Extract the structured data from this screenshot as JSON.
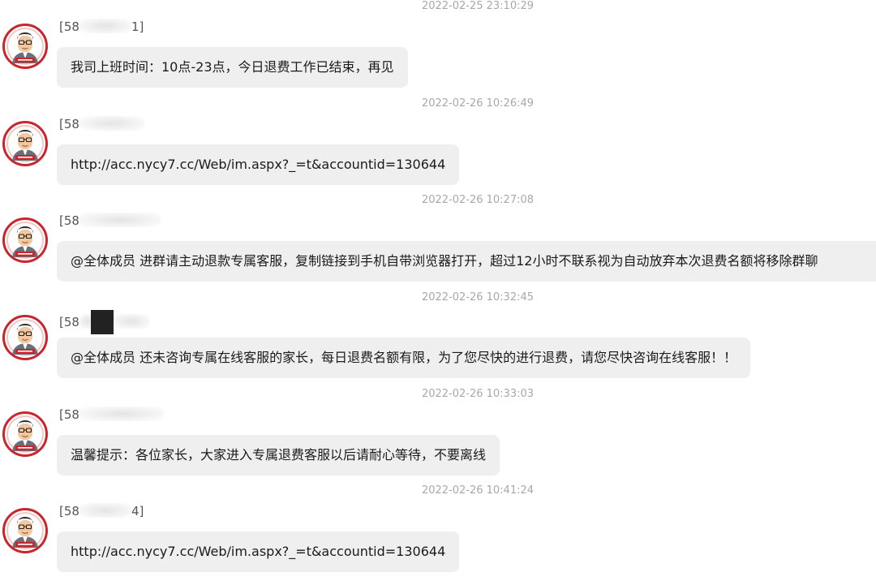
{
  "messages": [
    {
      "timestamp": "2022-02-25 23:10:29",
      "sender_prefix": "[58",
      "sender_suffix": "1]",
      "text": "我司上班时间：10点-23点，今日退费工作已结束，再见"
    },
    {
      "timestamp": "2022-02-26 10:26:49",
      "sender_prefix": "[58",
      "sender_suffix": "",
      "text": "http://acc.nycy7.cc/Web/im.aspx?_=t&accountid=130644"
    },
    {
      "timestamp": "2022-02-26 10:27:08",
      "sender_prefix": "[58",
      "sender_suffix": "",
      "text": "@全体成员 进群请主动退款专属客服，复制链接到手机自带浏览器打开，超过12小时不联系视为自动放弃本次退费名额将移除群聊"
    },
    {
      "timestamp": "2022-02-26 10:32:45",
      "sender_prefix": "[58",
      "sender_suffix": "",
      "text": "@全体成员 还未咨询专属在线客服的家长，每日退费名额有限，为了您尽快的进行退费，请您尽快咨询在线客服！！"
    },
    {
      "timestamp": "2022-02-26 10:33:03",
      "sender_prefix": "[58",
      "sender_suffix": "",
      "text": "温馨提示：各位家长，大家进入专属退费客服以后请耐心等待，不要离线"
    },
    {
      "timestamp": "2022-02-26 10:41:24",
      "sender_prefix": "[58",
      "sender_suffix": "4]",
      "text": "http://acc.nycy7.cc/Web/im.aspx?_=t&accountid=130644"
    }
  ],
  "colors": {
    "bubble_bg": "#efefef",
    "timestamp_text": "#a8a8a8",
    "avatar_ring": "#c9252c"
  },
  "icons": {
    "avatar": "cartoon-teacher-avatar-icon"
  }
}
